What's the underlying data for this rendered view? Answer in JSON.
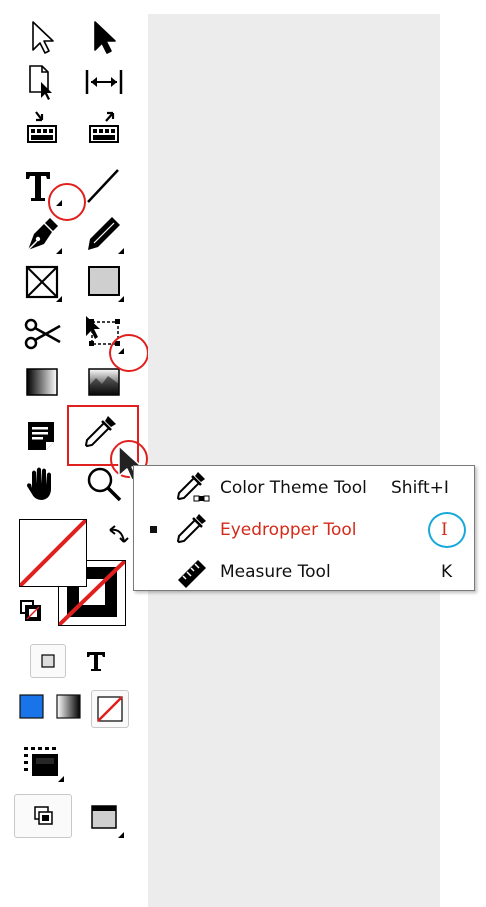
{
  "flyout": {
    "items": [
      {
        "label": "Color Theme Tool",
        "shortcut": "Shift+I",
        "icon": "color-theme-tool-icon",
        "selected": false
      },
      {
        "label": "Eyedropper Tool",
        "shortcut": "I",
        "icon": "eyedropper-icon",
        "selected": true
      },
      {
        "label": "Measure Tool",
        "shortcut": "K",
        "icon": "ruler-icon",
        "selected": false
      }
    ]
  },
  "tools": [
    "selection-tool",
    "direct-selection-tool",
    "page-tool",
    "gap-tool",
    "content-collector-tool",
    "content-placer-tool",
    "type-tool",
    "line-tool",
    "pen-tool",
    "pencil-tool",
    "rectangle-frame-tool",
    "rectangle-tool",
    "scissors-tool",
    "free-transform-tool",
    "gradient-swatch-tool",
    "gradient-feather-tool",
    "note-tool",
    "eyedropper-tool",
    "hand-tool",
    "zoom-tool"
  ],
  "colors": {
    "highlight_red": "#e0201e",
    "highlight_cyan": "#17a8dc",
    "selected_text": "#d42a1a",
    "apply_color": "#1874e8",
    "canvas": "#ececec"
  }
}
